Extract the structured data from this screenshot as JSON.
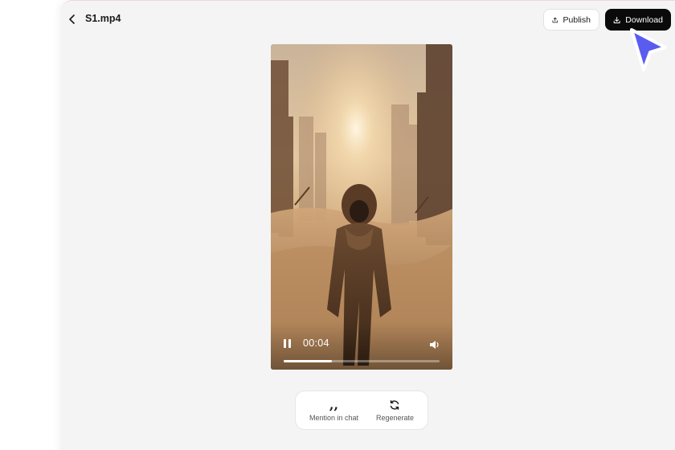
{
  "header": {
    "title": "S1.mp4",
    "back_icon": "chevron-left-icon",
    "publish_label": "Publish",
    "publish_icon": "upload-icon",
    "download_label": "Download",
    "download_icon": "download-icon"
  },
  "player": {
    "current_time": "00:04",
    "progress_fraction": 0.31,
    "state": "playing",
    "pause_icon": "pause-icon",
    "volume_icon": "volume-icon"
  },
  "actions": {
    "mention_label": "Mention in chat",
    "mention_icon": "quote-icon",
    "regenerate_label": "Regenerate",
    "regenerate_icon": "refresh-icon"
  },
  "colors": {
    "panel_bg": "#f4f4f4",
    "download_bg": "#0a0a0a",
    "cursor": "#5a5cf0"
  }
}
